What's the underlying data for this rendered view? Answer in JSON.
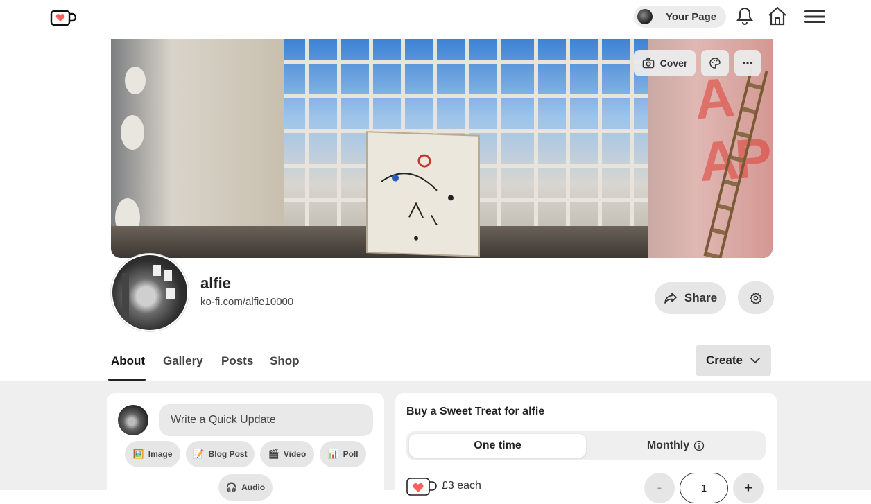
{
  "nav": {
    "your_page_label": "Your Page"
  },
  "cover": {
    "cover_button_label": "Cover"
  },
  "profile": {
    "name": "alfie",
    "url": "ko-fi.com/alfie10000",
    "share_label": "Share"
  },
  "tabs": [
    {
      "label": "About",
      "active": true
    },
    {
      "label": "Gallery",
      "active": false
    },
    {
      "label": "Posts",
      "active": false
    },
    {
      "label": "Shop",
      "active": false
    }
  ],
  "create_label": "Create",
  "feed": {
    "quick_update_placeholder": "Write a Quick Update",
    "post_types": [
      {
        "icon": "🖼️",
        "label": "Image"
      },
      {
        "icon": "📝",
        "label": "Blog Post"
      },
      {
        "icon": "🎬",
        "label": "Video"
      },
      {
        "icon": "📊",
        "label": "Poll"
      },
      {
        "icon": "🎧",
        "label": "Audio"
      }
    ]
  },
  "support": {
    "title": "Buy a Sweet Treat for alfie",
    "frequency_options": [
      "One time",
      "Monthly"
    ],
    "price_each": "£3 each",
    "minus_label": "-",
    "quantity": "1",
    "plus_label": "+"
  },
  "colors": {
    "accent_heart": "#ff5e5b",
    "page_background": "#efefef"
  }
}
